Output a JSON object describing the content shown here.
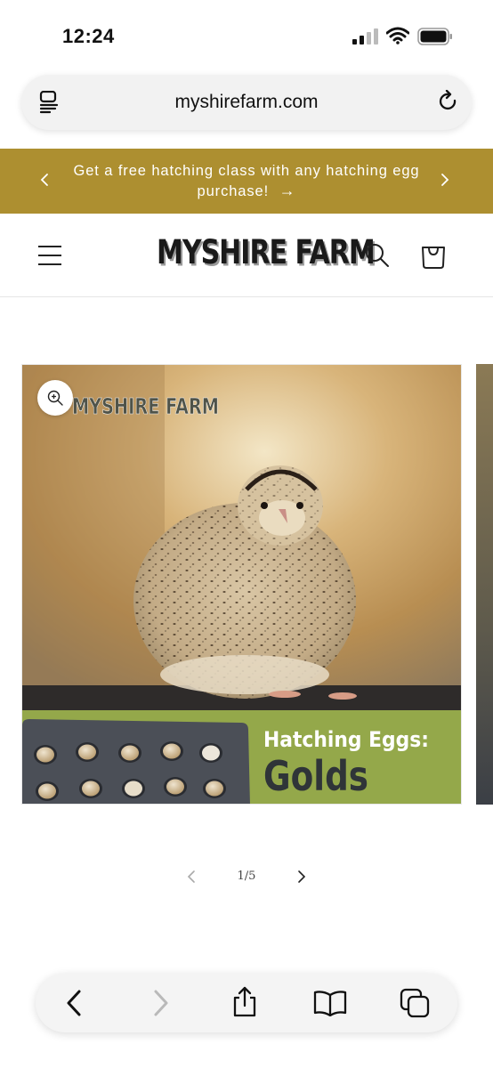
{
  "status_bar": {
    "time": "12:24"
  },
  "browser": {
    "url": "myshirefarm.com"
  },
  "announcement": {
    "text": "Get a free hatching class with any hatching egg purchase!",
    "arrow": "→"
  },
  "header": {
    "logo": "MYSHIRE FARM"
  },
  "product_image": {
    "watermark": "MYSHIRE FARM",
    "banner_line1": "Hatching Eggs:",
    "banner_line2": "Golds"
  },
  "slider": {
    "counter": "1/5"
  },
  "colors": {
    "announcement_bg": "#ad8f30",
    "banner_green": "#94a84a",
    "banner_text_dark": "#2f3438",
    "egg_tray": "#4b4f57"
  },
  "icons": {
    "status": [
      "signal-icon",
      "wifi-icon",
      "battery-icon"
    ],
    "browser": [
      "reader-icon",
      "reload-icon"
    ],
    "header": [
      "menu-icon",
      "search-icon",
      "cart-icon"
    ],
    "toolbar": [
      "back-icon",
      "forward-icon",
      "share-icon",
      "bookmarks-icon",
      "tabs-icon"
    ]
  }
}
